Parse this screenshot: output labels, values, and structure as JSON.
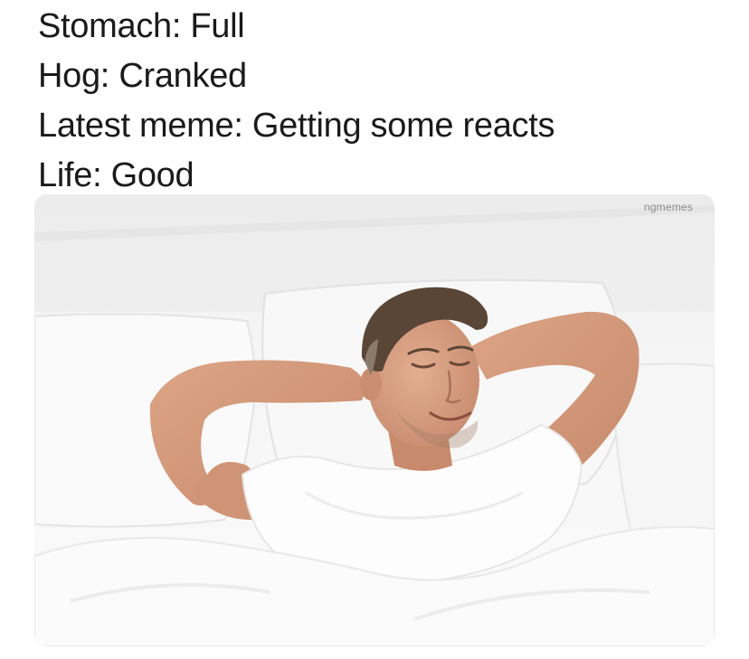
{
  "caption": {
    "lines": [
      "Stomach: Full",
      "Hog: Cranked",
      "Latest meme: Getting some reacts",
      "Life: Good"
    ]
  },
  "photo": {
    "watermark": "ngmemes",
    "subject": "man-relaxing-in-bed-icon"
  },
  "colors": {
    "text": "#1a1a1a",
    "background": "#ffffff",
    "bedding": "#f7f7f7",
    "skin": "#d9a184",
    "hair": "#5a4636"
  }
}
